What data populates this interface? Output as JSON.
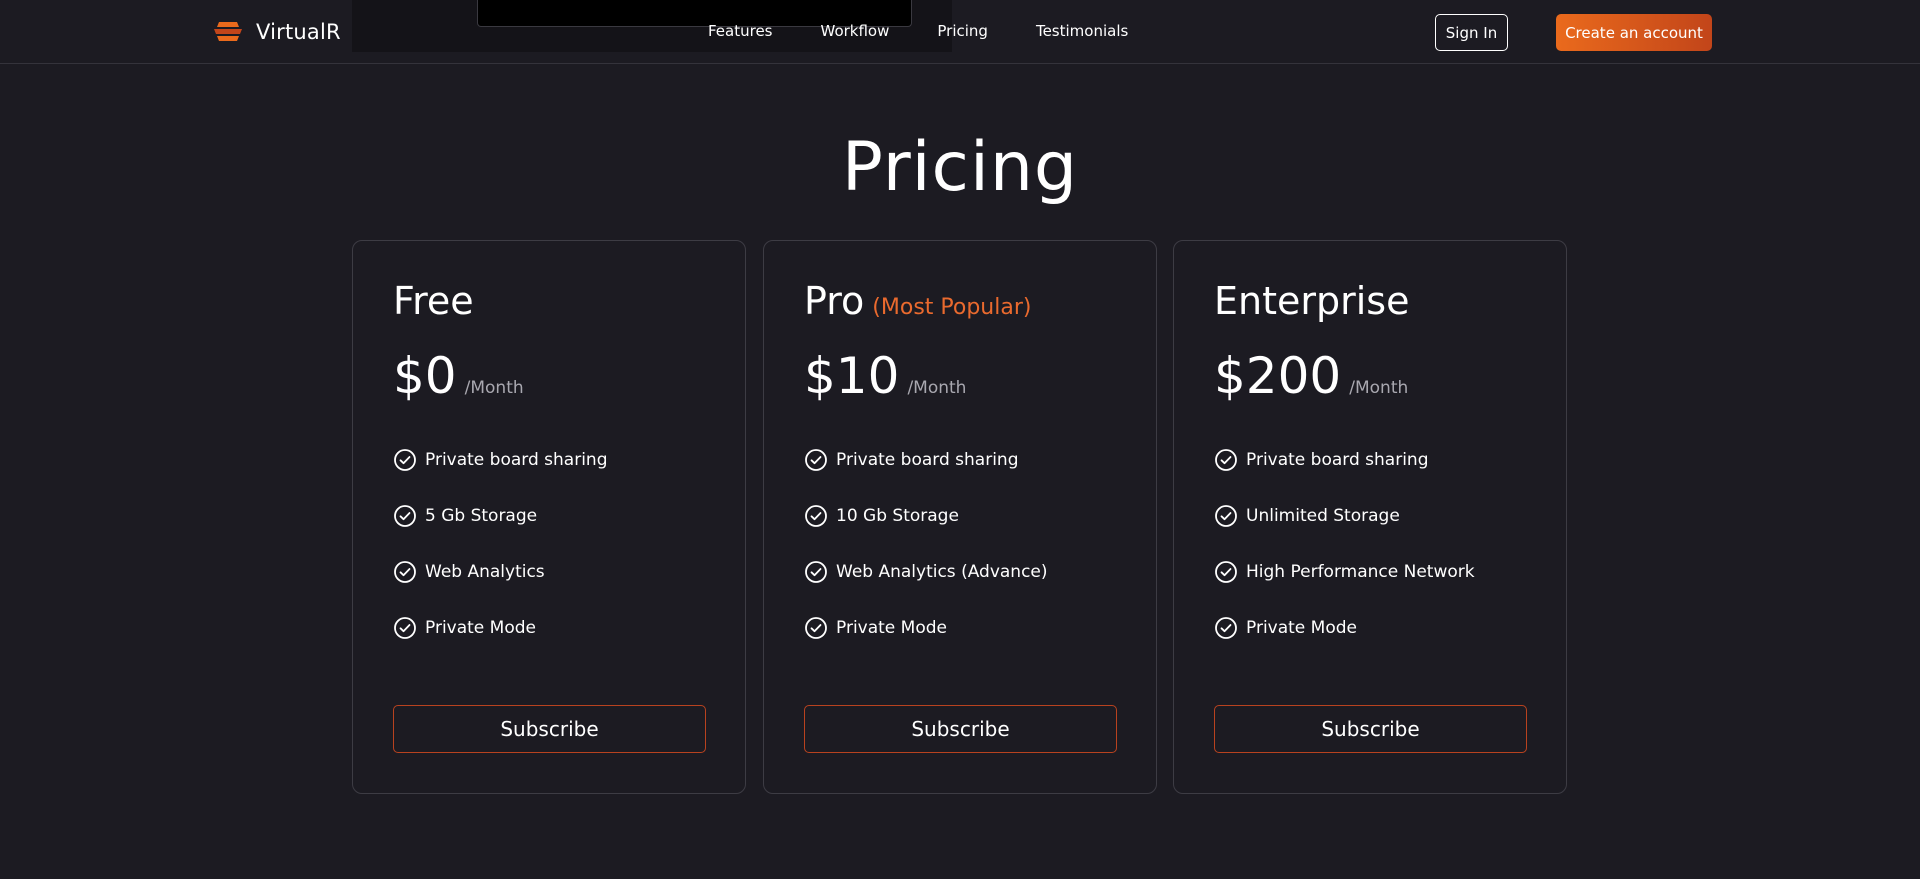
{
  "header": {
    "brand": "VirtualR",
    "nav": [
      {
        "label": "Features"
      },
      {
        "label": "Workflow"
      },
      {
        "label": "Pricing"
      },
      {
        "label": "Testimonials"
      }
    ],
    "sign_in_label": "Sign In",
    "create_account_label": "Create an account"
  },
  "pricing": {
    "title": "Pricing",
    "plans": [
      {
        "name": "Free",
        "badge": "",
        "price": "$0",
        "period": "/Month",
        "features": [
          "Private board sharing",
          "5 Gb Storage",
          "Web Analytics",
          "Private Mode"
        ],
        "cta": "Subscribe"
      },
      {
        "name": "Pro",
        "badge": "(Most Popular)",
        "price": "$10",
        "period": "/Month",
        "features": [
          "Private board sharing",
          "10 Gb Storage",
          "Web Analytics (Advance)",
          "Private Mode"
        ],
        "cta": "Subscribe"
      },
      {
        "name": "Enterprise",
        "badge": "",
        "price": "$200",
        "period": "/Month",
        "features": [
          "Private board sharing",
          "Unlimited Storage",
          "High Performance Network",
          "Private Mode"
        ],
        "cta": "Subscribe"
      }
    ]
  },
  "colors": {
    "background": "#1c1b22",
    "accent": "#ea6a1c",
    "accent_dark": "#c2451a",
    "badge": "#ea6a2e",
    "muted_text": "#a9a8b0",
    "card_border": "#3d3c44"
  },
  "icons": {
    "logo": "virtualr-logo-icon",
    "feature": "check-circle-icon"
  }
}
